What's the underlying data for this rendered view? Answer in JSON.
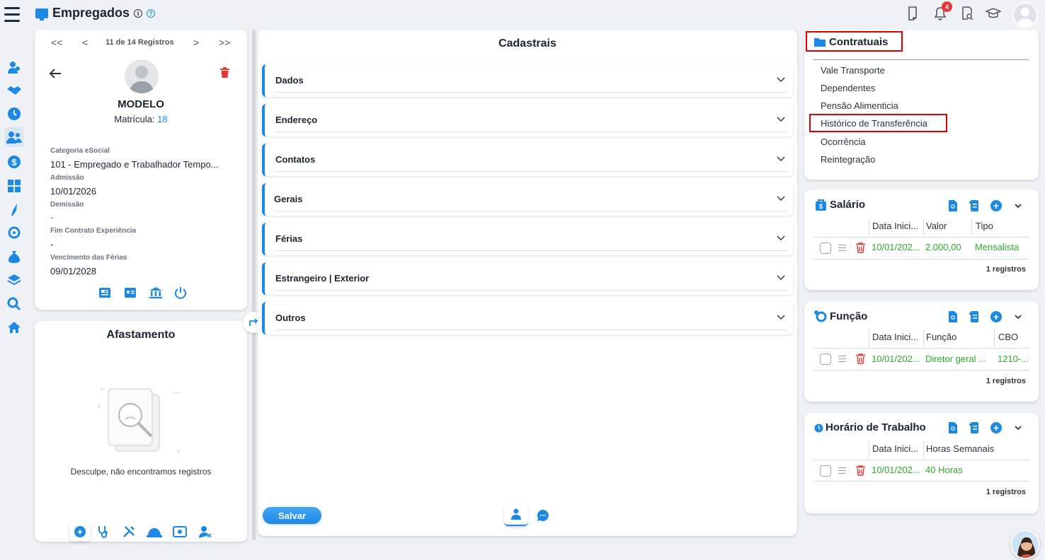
{
  "header": {
    "title": "Empregados",
    "info_icon": "info-icon",
    "help_icon": "help-icon",
    "notification_count": "4"
  },
  "employee": {
    "nav_label": "11 de 14 Registros",
    "first": "<<",
    "prev": "<",
    "next": ">",
    "last": ">>",
    "name": "MODELO",
    "matricula_label": "Matrícula:",
    "matricula_value": "18",
    "fields": [
      {
        "label": "Categoria eSocial",
        "value": "101 - Empregado e Trabalhador Tempo..."
      },
      {
        "label": "Admissão",
        "value": "10/01/2026"
      },
      {
        "label": "Demissão",
        "value": "-"
      },
      {
        "label": "Fim Contrato Experiência",
        "value": "-"
      },
      {
        "label": "Vencimento das Férias",
        "value": "09/01/2028"
      }
    ]
  },
  "afastamento": {
    "title": "Afastamento",
    "empty_text": "Desculpe, não encontramos registros"
  },
  "cadastrais": {
    "title": "Cadastrais",
    "sections": [
      "Dados",
      "Endereço",
      "Contatos",
      "Gerais",
      "Férias",
      "Estrangeiro | Exterior",
      "Outros"
    ],
    "save_label": "Salvar"
  },
  "contratuais": {
    "title": "Contratuais",
    "links": [
      "Vale Transporte",
      "Dependentes",
      "Pensão Alimenticia",
      "Histórico de Transferência",
      "Ocorrência",
      "Reintegração"
    ]
  },
  "salario": {
    "title": "Salário",
    "columns": [
      "Data Inici...",
      "Valor",
      "Tipo"
    ],
    "row": [
      "10/01/202...",
      "2.000,00",
      "Mensalista"
    ],
    "count": "1 registros"
  },
  "funcao": {
    "title": "Função",
    "columns": [
      "Data Inici...",
      "Função",
      "CBO"
    ],
    "row": [
      "10/01/202...",
      "Diretor geral ...",
      "1210-..."
    ],
    "count": "1 registros"
  },
  "horario": {
    "title": "Horário de Trabalho",
    "columns": [
      "Data Inici...",
      "Horas Semanais"
    ],
    "row": [
      "10/01/202...",
      "40 Horas"
    ],
    "count": "1 registros"
  },
  "colors": {
    "accent": "#1e88e5",
    "green": "#2eaa2e",
    "danger": "#e53935",
    "highlight": "#e00000"
  }
}
